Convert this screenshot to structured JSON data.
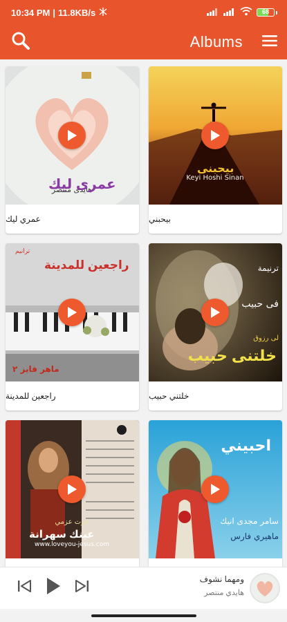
{
  "status": {
    "time": "10:34 PM",
    "network_speed": "11.8KB/s",
    "battery": "68"
  },
  "app_bar": {
    "title": "Albums"
  },
  "albums": [
    {
      "title": "عمري ليك",
      "cover_text": "عمرى ليك"
    },
    {
      "title": "بيحبني",
      "cover_text": "بيحبنى"
    },
    {
      "title": "راجعين للمدينة",
      "cover_text": "راجعين للمدينة"
    },
    {
      "title": "خلتني حبيب",
      "cover_text": "خلتنى حبيب"
    },
    {
      "title": "عينك سهرانة",
      "cover_text": "عينك سهرانة"
    },
    {
      "title": "احبيني",
      "cover_text": "احبيني"
    }
  ],
  "player": {
    "track_title": "ومهما نشوف",
    "track_artist": "هايدي منتصر"
  },
  "colors": {
    "primary": "#e8552c",
    "play_button": "#ee5a2d"
  }
}
